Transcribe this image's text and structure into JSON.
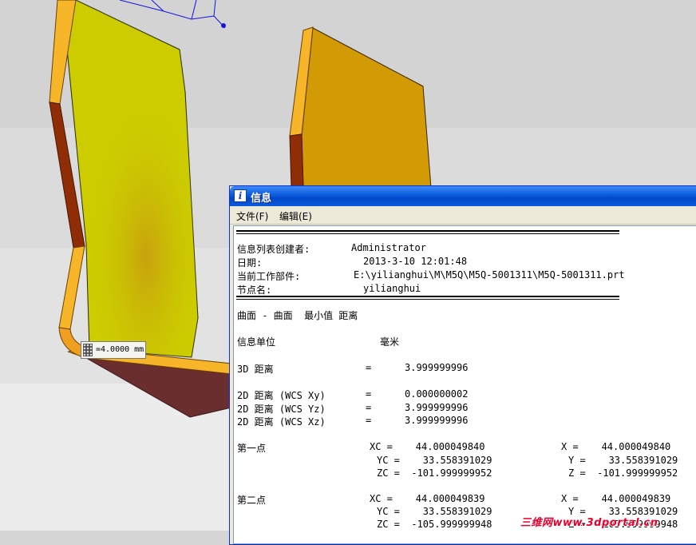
{
  "viewport": {
    "dimension_label": "=4.0000 mm",
    "colors": {
      "background": "#d6d6d6",
      "left_panel_face": "#cccc00",
      "right_panel_face": "#d29a05",
      "edge_orange": "#f7b52a",
      "edge_dark": "#8f2d06",
      "bottom_panel": "#6b2e2e"
    }
  },
  "window": {
    "title": "信息",
    "icon": "info-icon",
    "menu": {
      "file": "文件(F)",
      "edit": "编辑(E)"
    },
    "content": {
      "rows": {
        "creator_label": "信息列表创建者:",
        "creator_value": "Administrator",
        "date_label": "日期:",
        "date_value": "2013-3-10 12:01:48",
        "workpart_label": "当前工作部件:",
        "workpart_value": "E:\\yilianghui\\M\\M5Q\\M5Q-5001311\\M5Q-5001311.prt",
        "node_label": "节点名:",
        "node_value": "yilianghui",
        "measure_title": "曲面 - 曲面  最小值 距离",
        "units_label": "信息单位",
        "units_value": "毫米",
        "dist3d_label": "3D 距离",
        "dist3d_value": "3.999999996",
        "dist2d_xy_label": "2D 距离 (WCS Xy)",
        "dist2d_xy_value": "0.000000002",
        "dist2d_yz_label": "2D 距离 (WCS Yz)",
        "dist2d_yz_value": "3.999999996",
        "dist2d_xz_label": "2D 距离 (WCS Xz)",
        "dist2d_xz_value": "3.999999996",
        "equals": "=",
        "point1_label": "第一点",
        "p1_xc": "XC =    44.000049840",
        "p1_yc": "YC =    33.558391029",
        "p1_zc": "ZC =  -101.999999952",
        "p1_x": "X =    44.000049840",
        "p1_y": "Y =    33.558391029",
        "p1_z": "Z =  -101.999999952",
        "point2_label": "第二点",
        "p2_xc": "XC =    44.000049839",
        "p2_yc": "YC =    33.558391029",
        "p2_zc": "ZC =  -105.999999948",
        "p2_x": "X =    44.000049839",
        "p2_y": "Y =    33.558391029",
        "p2_z": "Z =  -105.999999948"
      }
    }
  },
  "watermark": "三维网www.3dportal.cn"
}
